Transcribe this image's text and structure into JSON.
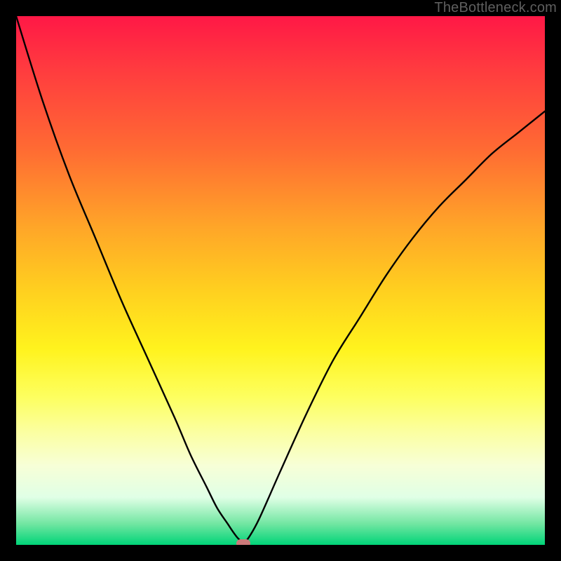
{
  "watermark": "TheBottleneck.com",
  "chart_data": {
    "type": "line",
    "title": "",
    "xlabel": "",
    "ylabel": "",
    "xlim": [
      0,
      100
    ],
    "ylim": [
      0,
      100
    ],
    "grid": false,
    "x": [
      0,
      5,
      10,
      15,
      20,
      25,
      30,
      33,
      36,
      38,
      40,
      41,
      42,
      43,
      44,
      46,
      50,
      55,
      60,
      65,
      70,
      75,
      80,
      85,
      90,
      95,
      100
    ],
    "y": [
      100,
      84,
      70,
      58,
      46,
      35,
      24,
      17,
      11,
      7,
      4,
      2.5,
      1.2,
      0.5,
      1.4,
      5,
      14,
      25,
      35,
      43,
      51,
      58,
      64,
      69,
      74,
      78,
      82
    ],
    "marker": {
      "x": 43,
      "y": 0.3
    },
    "gradient_colors": {
      "top": "#ff1846",
      "mid_high": "#ffa628",
      "mid": "#fff31e",
      "mid_low": "#fbffa4",
      "bottom": "#00d478"
    }
  }
}
